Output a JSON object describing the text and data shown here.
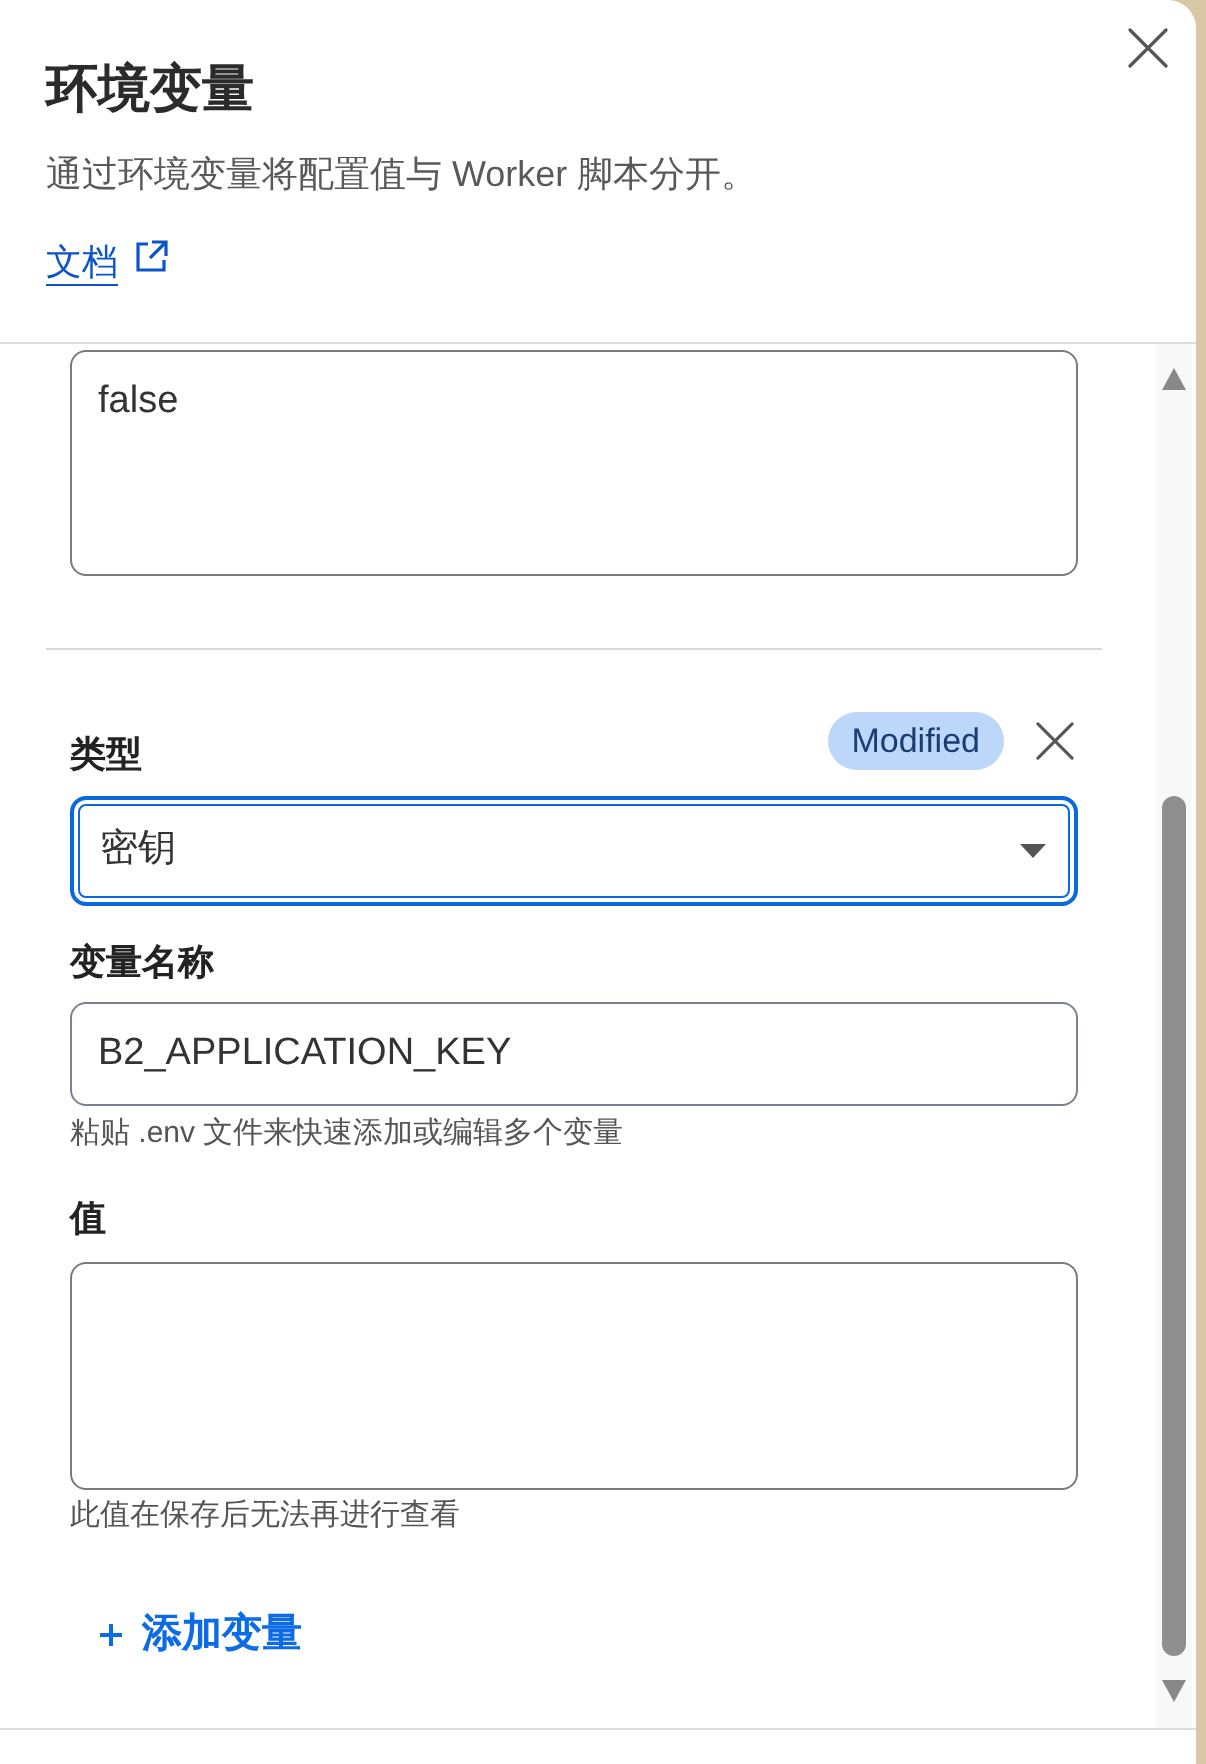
{
  "panel": {
    "title": "环境变量",
    "description": "通过环境变量将配置值与 Worker 脚本分开。",
    "docs_link": "文档"
  },
  "variables": [
    {
      "value_field": {
        "value": "false"
      }
    },
    {
      "badge": "Modified",
      "type_field": {
        "label": "类型",
        "value": "密钥",
        "focused": true
      },
      "name_field": {
        "label": "变量名称",
        "value": "B2_APPLICATION_KEY",
        "hint": "粘贴 .env 文件来快速添加或编辑多个变量"
      },
      "value_field": {
        "label": "值",
        "hint": "此值在保存后无法再进行查看"
      }
    }
  ],
  "add_button": {
    "label": "添加变量"
  }
}
